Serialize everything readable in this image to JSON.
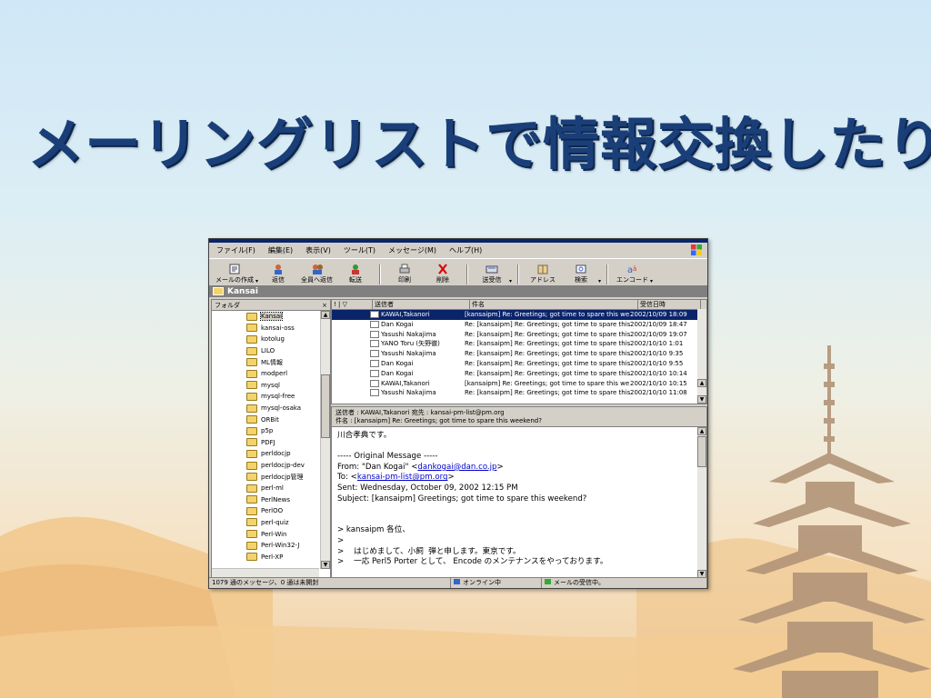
{
  "slide": {
    "title": "メーリングリストで情報交換したり"
  },
  "window": {
    "menu": [
      "ファイル(F)",
      "編集(E)",
      "表示(V)",
      "ツール(T)",
      "メッセージ(M)",
      "ヘルプ(H)"
    ],
    "toolbar": [
      {
        "label": "メールの作成",
        "icon": "new-mail-icon"
      },
      {
        "label": "返信",
        "icon": "reply-icon"
      },
      {
        "label": "全員へ返信",
        "icon": "reply-all-icon"
      },
      {
        "label": "転送",
        "icon": "forward-icon"
      },
      {
        "label": "印刷",
        "icon": "print-icon"
      },
      {
        "label": "削除",
        "icon": "delete-icon"
      },
      {
        "label": "送受信",
        "icon": "send-receive-icon"
      },
      {
        "label": "アドレス",
        "icon": "address-book-icon"
      },
      {
        "label": "検索",
        "icon": "search-icon"
      },
      {
        "label": "エンコード",
        "icon": "encode-icon"
      }
    ],
    "current_folder": "Kansai",
    "folder_pane_title": "フォルダ",
    "folder_close": "×",
    "folders": [
      "Kansai",
      "kansai-oss",
      "kotolug",
      "LILO",
      "ML情報",
      "modperl",
      "mysql",
      "mysql-free",
      "mysql-osaka",
      "ORBit",
      "p5p",
      "PDFJ",
      "perldocjp",
      "perldocjp-dev",
      "perldocjp管理",
      "perl-ml",
      "PerlNews",
      "PerlOO",
      "perl-quiz",
      "Perl-Win",
      "Perl-Win32-J",
      "Perl-XP"
    ],
    "list_headers": {
      "flags": "! | ▽",
      "from": "送信者",
      "subject": "件名",
      "date": "受信日時"
    },
    "messages": [
      {
        "from": "KAWAI,Takanori",
        "subject": "[kansaipm] Re: Greetings; got time to spare this we...",
        "date": "2002/10/09 18:09",
        "selected": true
      },
      {
        "from": "Dan Kogai",
        "subject": "Re: [kansaipm] Re: Greetings; got time to spare this...",
        "date": "2002/10/09 18:47"
      },
      {
        "from": "Yasushi Nakajima",
        "subject": "Re: [kansaipm] Re: Greetings; got time to spare this...",
        "date": "2002/10/09 19:07"
      },
      {
        "from": "YANO Toru (矢野徹)",
        "subject": "Re: [kansaipm] Re: Greetings; got time to spare this...",
        "date": "2002/10/10 1:01"
      },
      {
        "from": "Yasushi Nakajima",
        "subject": "Re: [kansaipm] Re: Greetings; got time to spare this...",
        "date": "2002/10/10 9:35"
      },
      {
        "from": "Dan Kogai",
        "subject": "Re: [kansaipm] Re: Greetings; got time to spare this...",
        "date": "2002/10/10 9:55"
      },
      {
        "from": "Dan Kogai",
        "subject": "Re: [kansaipm] Re: Greetings; got time to spare this...",
        "date": "2002/10/10 10:14"
      },
      {
        "from": "KAWAI,Takanori",
        "subject": "[kansaipm] Re: Greetings; got time to spare this we...",
        "date": "2002/10/10 10:15"
      },
      {
        "from": "Yasushi Nakajima",
        "subject": "Re: [kansaipm] Re: Greetings; got time to spare this...",
        "date": "2002/10/10 11:08"
      }
    ],
    "preview_header": {
      "line1": "送信者 : KAWAI,Takanori  宛先 : kansai-pm-list@pm.org",
      "line2": "件名 : [kansaipm] Re: Greetings; got time to spare this weekend?"
    },
    "preview_body": {
      "l1": "川合孝典です。",
      "l2": "----- Original Message -----",
      "l3a": "From: \"Dan Kogai\" <",
      "l3link": "dankogai@dan.co.jp",
      "l3b": ">",
      "l4a": "To: <",
      "l4link": "kansai-pm-list@pm.org",
      "l4b": ">",
      "l5": "Sent: Wednesday, October 09, 2002 12:15 PM",
      "l6": "Subject: [kansaipm] Greetings; got time to spare this weekend?",
      "l7": "> kansaipm 各位、",
      "l8": ">",
      "l9": ">    はじめまして、小飼  弾と申します。東京です。",
      "l10": ">    一応 Perl5 Porter として、 Encode のメンテナンスをやっております。"
    },
    "status": {
      "count": "1079 通のメッセージ、0 通は未開封",
      "online": "オンライン中",
      "receiving": "メールの受信中。"
    }
  }
}
